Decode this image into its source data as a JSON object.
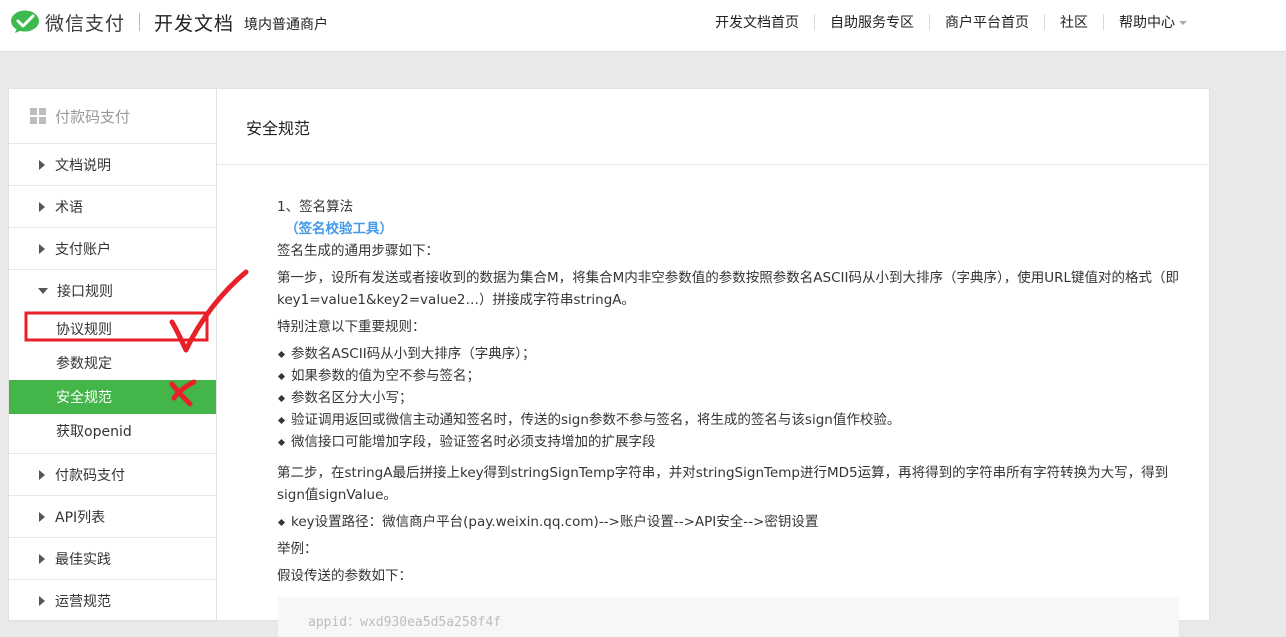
{
  "header": {
    "logo_text": "微信支付",
    "title": "开发文档",
    "subtitle": "境内普通商户",
    "nav": [
      "开发文档首页",
      "自助服务专区",
      "商户平台首页",
      "社区",
      "帮助中心"
    ]
  },
  "sidebar": {
    "heading": "付款码支付",
    "items_before": [
      "文档说明",
      "术语",
      "支付账户"
    ],
    "open_group": {
      "label": "接口规则",
      "children": [
        "协议规则",
        "参数规定",
        "安全规范",
        "获取openid"
      ],
      "active_index": 2
    },
    "items_after": [
      "付款码支付",
      "API列表",
      "最佳实践",
      "运营规范"
    ]
  },
  "main": {
    "title": "安全规范",
    "section_title": "1、签名算法",
    "tool_link": "（签名校验工具）",
    "intro": "签名生成的通用步骤如下：",
    "step1": "第一步，设所有发送或者接收到的数据为集合M，将集合M内非空参数值的参数按照参数名ASCII码从小到大排序（字典序），使用URL键值对的格式（即key1=value1&key2=value2…）拼接成字符串stringA。",
    "notice": "特别注意以下重要规则：",
    "rules": [
      "参数名ASCII码从小到大排序（字典序）；",
      "如果参数的值为空不参与签名；",
      "参数名区分大小写；",
      "验证调用返回或微信主动通知签名时，传送的sign参数不参与签名，将生成的签名与该sign值作校验。",
      "微信接口可能增加字段，验证签名时必须支持增加的扩展字段"
    ],
    "step2": "第二步，在stringA最后拼接上key得到stringSignTemp字符串，并对stringSignTemp进行MD5运算，再将得到的字符串所有字符转换为大写，得到sign值signValue。",
    "key_path": "key设置路径：微信商户平台(pay.weixin.qq.com)-->账户设置-->API安全-->密钥设置",
    "example_label": "举例：",
    "example_intro": "假设传送的参数如下：",
    "code_line": "appid：wxd930ea5d5a258f4f"
  },
  "colors": {
    "active_green": "#44b549",
    "link_blue": "#459ae9",
    "annotation_red": "#e8202a"
  }
}
